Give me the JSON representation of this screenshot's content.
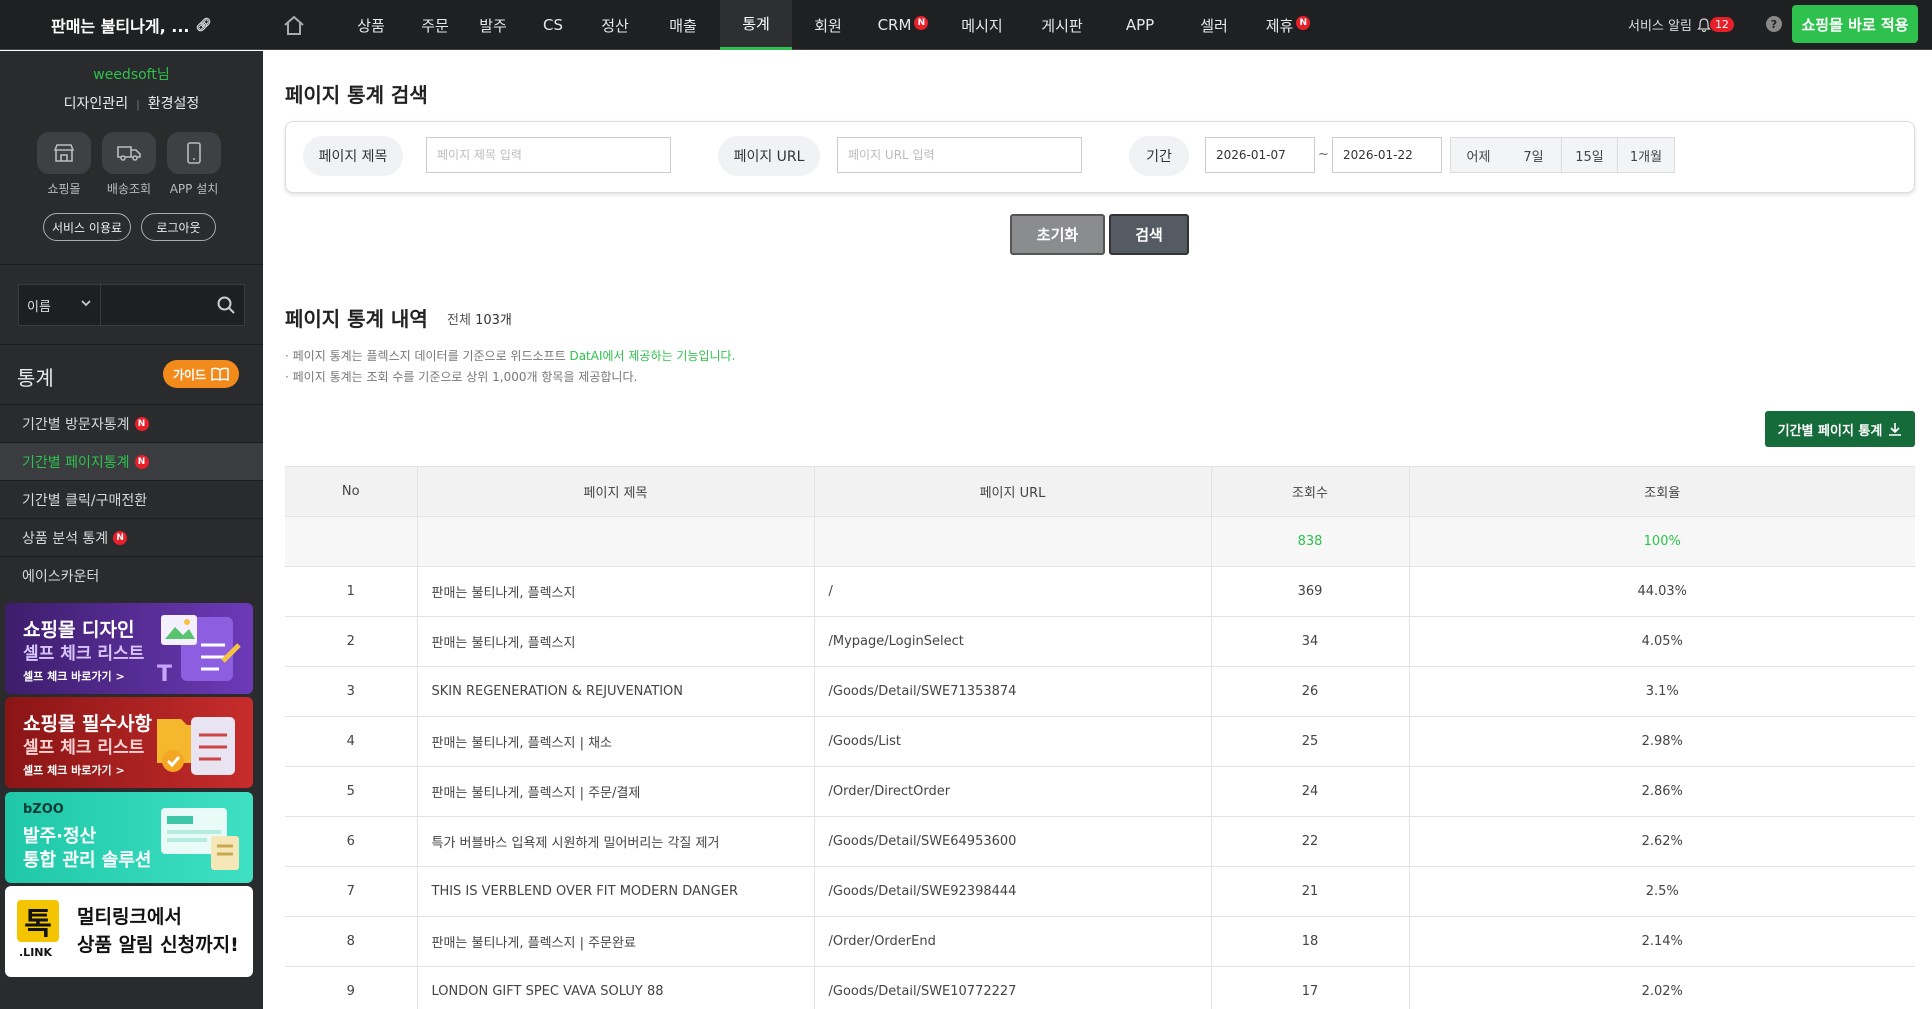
{
  "header": {
    "brand": "판매는 불티나게, ...",
    "nav": [
      {
        "label": "상품",
        "badge": ""
      },
      {
        "label": "주문",
        "badge": ""
      },
      {
        "label": "발주",
        "badge": ""
      },
      {
        "label": "CS",
        "badge": ""
      },
      {
        "label": "정산",
        "badge": ""
      },
      {
        "label": "매출",
        "badge": ""
      },
      {
        "label": "통계",
        "badge": "",
        "active": true
      },
      {
        "label": "회원",
        "badge": ""
      },
      {
        "label": "CRM",
        "badge": "N"
      },
      {
        "label": "메시지",
        "badge": ""
      },
      {
        "label": "게시판",
        "badge": ""
      },
      {
        "label": "APP",
        "badge": ""
      },
      {
        "label": "셀러",
        "badge": ""
      },
      {
        "label": "제휴",
        "badge": "N"
      }
    ],
    "service_alert": "서비스 알림",
    "alert_count": "12",
    "help": "?",
    "apply_button": "쇼핑몰 바로 적용"
  },
  "sidebar": {
    "user": "weedsoft님",
    "link_design": "디자인관리",
    "link_settings": "환경설정",
    "quick_mall": "쇼핑몰",
    "quick_delivery": "배송조회",
    "quick_app": "APP 설치",
    "service_fee": "서비스 이용료",
    "logout": "로그아웃",
    "search_select": "이름",
    "section_title": "통계",
    "guide": "가이드",
    "menu": [
      {
        "label": "기간별 방문자통계",
        "badge": "N"
      },
      {
        "label": "기간별 페이지통계",
        "badge": "N",
        "active": true
      },
      {
        "label": "기간별 클릭/구매전환",
        "badge": ""
      },
      {
        "label": "상품 분석 통계",
        "badge": "N"
      },
      {
        "label": "에이스카운터",
        "badge": ""
      }
    ],
    "banners": {
      "b1_line1": "쇼핑몰 디자인",
      "b1_line2": "셀프 체크 리스트",
      "b1_line3": "셀프 체크 바로가기 >",
      "b2_line1": "쇼핑몰 필수사항",
      "b2_line2": "셀프 체크 리스트",
      "b2_line3": "셀프 체크 바로가기 >",
      "b3_logo": "bZOO",
      "b3_line1": "발주·정산",
      "b3_line2": "통합 관리 솔루션",
      "b4_logo_sub": ".LINK",
      "b4_line1": "멀티링크에서",
      "b4_line2": "상품 알림 신청까지!"
    }
  },
  "search": {
    "title": "페이지 통계 검색",
    "label_title": "페이지 제목",
    "placeholder_title": "페이지 제목 입력",
    "label_url": "페이지 URL",
    "placeholder_url": "페이지 URL 입력",
    "label_period": "기간",
    "date_from": "2026-01-07",
    "tilde": "~",
    "date_to": "2026-01-22",
    "quick_ranges": [
      "어제",
      "7일",
      "15일",
      "1개월"
    ],
    "reset": "초기화",
    "submit": "검색"
  },
  "list": {
    "title": "페이지 통계 내역",
    "total_label": "전체",
    "total_count": "103개",
    "note1_prefix": "· 페이지 통계는 플렉스지 데이터를 기준으로 위드소프트 ",
    "note1_highlight": "DatAI에서 제공하는 기능입니다.",
    "note2": "· 페이지 통계는 조회 수를 기준으로 상위 1,000개 항목을 제공합니다.",
    "download": "기간별 페이지 통계",
    "columns": [
      "No",
      "페이지 제목",
      "페이지 URL",
      "조회수",
      "조회율"
    ],
    "summary": {
      "views": "838",
      "rate": "100%"
    },
    "rows": [
      {
        "no": "1",
        "title": "판매는 불티나게, 플렉스지",
        "url": "/",
        "views": "369",
        "rate": "44.03%"
      },
      {
        "no": "2",
        "title": "판매는 불티나게, 플렉스지",
        "url": "/Mypage/LoginSelect",
        "views": "34",
        "rate": "4.05%"
      },
      {
        "no": "3",
        "title": "SKIN REGENERATION & REJUVENATION",
        "url": "/Goods/Detail/SWE71353874",
        "views": "26",
        "rate": "3.1%"
      },
      {
        "no": "4",
        "title": "판매는 불티나게, 플렉스지 | 채소",
        "url": "/Goods/List",
        "views": "25",
        "rate": "2.98%"
      },
      {
        "no": "5",
        "title": "판매는 불티나게, 플렉스지 | 주문/결제",
        "url": "/Order/DirectOrder",
        "views": "24",
        "rate": "2.86%"
      },
      {
        "no": "6",
        "title": "특가 버블바스 입욕제 시원하게 밀어버리는 각질 제거",
        "url": "/Goods/Detail/SWE64953600",
        "views": "22",
        "rate": "2.62%"
      },
      {
        "no": "7",
        "title": "THIS IS VERBLEND OVER FIT MODERN DANGER",
        "url": "/Goods/Detail/SWE92398444",
        "views": "21",
        "rate": "2.5%"
      },
      {
        "no": "8",
        "title": "판매는 불티나게, 플렉스지 | 주문완료",
        "url": "/Order/OrderEnd",
        "views": "18",
        "rate": "2.14%"
      },
      {
        "no": "9",
        "title": "LONDON GIFT SPEC VAVA SOLUY 88",
        "url": "/Goods/Detail/SWE10772227",
        "views": "17",
        "rate": "2.02%"
      }
    ]
  },
  "colors": {
    "accent": "#2ec14d",
    "topbar": "#1f2021",
    "sidebar": "#2a2b2d",
    "download": "#156b3a",
    "badge": "#e8202a"
  }
}
